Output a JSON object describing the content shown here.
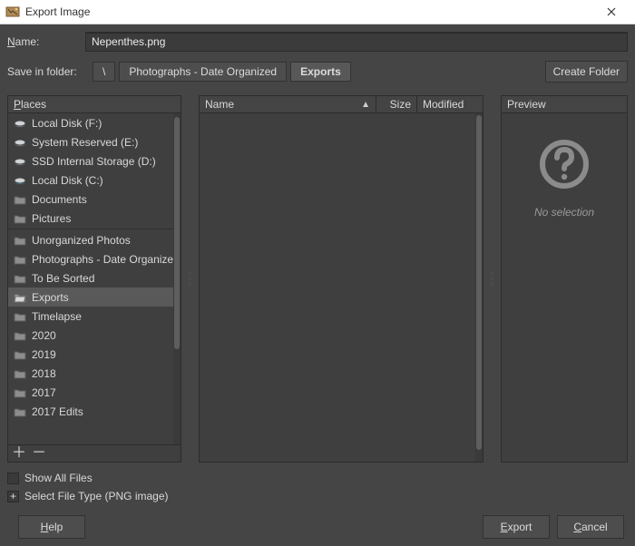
{
  "window": {
    "title": "Export Image"
  },
  "form": {
    "name_label": "Name:",
    "name_value": "Nepenthes.png",
    "save_in_label": "Save in folder:",
    "create_folder": "Create Folder"
  },
  "breadcrumbs": [
    {
      "label": "\\"
    },
    {
      "label": "Photographs - Date Organized"
    },
    {
      "label": "Exports",
      "active": true
    }
  ],
  "places": {
    "header": "Places",
    "items": [
      {
        "icon": "disk",
        "label": "Local Disk (F:)"
      },
      {
        "icon": "disk",
        "label": "System Reserved (E:)"
      },
      {
        "icon": "disk",
        "label": "SSD Internal Storage (D:)"
      },
      {
        "icon": "disk-c",
        "label": "Local Disk (C:)"
      },
      {
        "icon": "folder",
        "label": "Documents"
      },
      {
        "icon": "folder",
        "label": "Pictures"
      },
      {
        "sep": true
      },
      {
        "icon": "folder",
        "label": "Unorganized Photos"
      },
      {
        "icon": "folder",
        "label": "Photographs - Date Organized"
      },
      {
        "icon": "folder",
        "label": "To Be Sorted"
      },
      {
        "icon": "folder-open",
        "label": "Exports",
        "selected": true
      },
      {
        "icon": "folder",
        "label": "Timelapse"
      },
      {
        "icon": "folder",
        "label": "2020"
      },
      {
        "icon": "folder",
        "label": "2019"
      },
      {
        "icon": "folder",
        "label": "2018"
      },
      {
        "icon": "folder",
        "label": "2017"
      },
      {
        "icon": "folder",
        "label": "2017 Edits"
      }
    ]
  },
  "files": {
    "columns": {
      "name": "Name",
      "size": "Size",
      "modified": "Modified"
    }
  },
  "preview": {
    "header": "Preview",
    "no_selection": "No selection"
  },
  "options": {
    "show_all_files": "Show All Files",
    "select_file_type": "Select File Type (PNG image)"
  },
  "buttons": {
    "help": "Help",
    "export": "Export",
    "cancel": "Cancel"
  }
}
